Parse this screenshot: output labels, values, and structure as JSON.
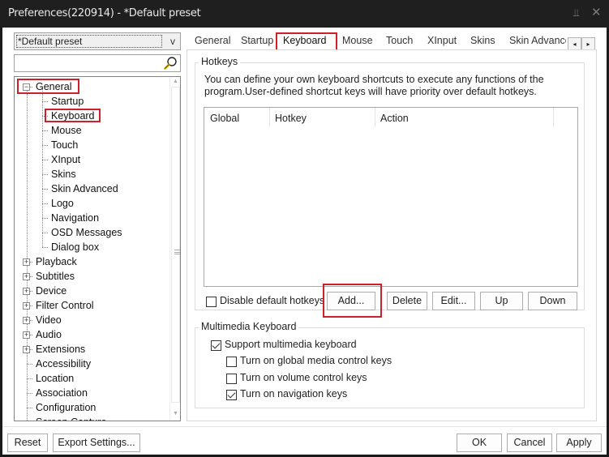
{
  "window": {
    "title": "Preferences(220914) - *Default preset",
    "pin_icon": "pin-icon",
    "close_icon": "close-icon"
  },
  "sidebar": {
    "preset_value": "*Default preset",
    "preset_arrow": "v",
    "search_placeholder": "",
    "search_icon": "magnifier-icon",
    "tree": [
      {
        "label": "General",
        "expander": "−",
        "expanded": true,
        "highlighted": true
      },
      {
        "label": "Startup",
        "child": true
      },
      {
        "label": "Keyboard",
        "child": true,
        "highlighted": true,
        "selected": true
      },
      {
        "label": "Mouse",
        "child": true
      },
      {
        "label": "Touch",
        "child": true
      },
      {
        "label": "XInput",
        "child": true
      },
      {
        "label": "Skins",
        "child": true
      },
      {
        "label": "Skin Advanced",
        "child": true
      },
      {
        "label": "Logo",
        "child": true
      },
      {
        "label": "Navigation",
        "child": true
      },
      {
        "label": "OSD Messages",
        "child": true
      },
      {
        "label": "Dialog box",
        "child": true
      },
      {
        "label": "Playback",
        "expander": "+"
      },
      {
        "label": "Subtitles",
        "expander": "+"
      },
      {
        "label": "Device",
        "expander": "+"
      },
      {
        "label": "Filter Control",
        "expander": "+"
      },
      {
        "label": "Video",
        "expander": "+"
      },
      {
        "label": "Audio",
        "expander": "+"
      },
      {
        "label": "Extensions",
        "expander": "+"
      },
      {
        "label": "Accessibility"
      },
      {
        "label": "Location"
      },
      {
        "label": "Association"
      },
      {
        "label": "Configuration"
      },
      {
        "label": "Screen Capture"
      }
    ]
  },
  "tabs": {
    "items": [
      "General",
      "Startup",
      "Keyboard",
      "Mouse",
      "Touch",
      "XInput",
      "Skins",
      "Skin Advance"
    ],
    "active": "Keyboard",
    "scroll_left": "◂",
    "scroll_right": "▸"
  },
  "hotkeys": {
    "group_title": "Hotkeys",
    "description_line1": "You can define your own keyboard shortcuts to execute any functions of the",
    "description_line2": "program.User-defined shortcut keys will have priority over default hotkeys.",
    "columns": [
      "Global",
      "Hotkey",
      "Action"
    ],
    "rows": [],
    "disable_default": {
      "label": "Disable default hotkeys",
      "checked": false
    },
    "buttons": {
      "add": "Add...",
      "delete": "Delete",
      "edit": "Edit...",
      "up": "Up",
      "down": "Down"
    }
  },
  "multimedia": {
    "group_title": "Multimedia Keyboard",
    "options": [
      {
        "label": "Support multimedia keyboard",
        "checked": true
      },
      {
        "label": "Turn on global media control keys",
        "checked": false
      },
      {
        "label": "Turn on volume control keys",
        "checked": false
      },
      {
        "label": "Turn on navigation keys",
        "checked": true
      }
    ]
  },
  "footer": {
    "reset": "Reset",
    "export": "Export Settings...",
    "ok": "OK",
    "cancel": "Cancel",
    "apply": "Apply"
  },
  "colors": {
    "highlight": "#d01f2a",
    "titlebar": "#1f1f1f"
  }
}
